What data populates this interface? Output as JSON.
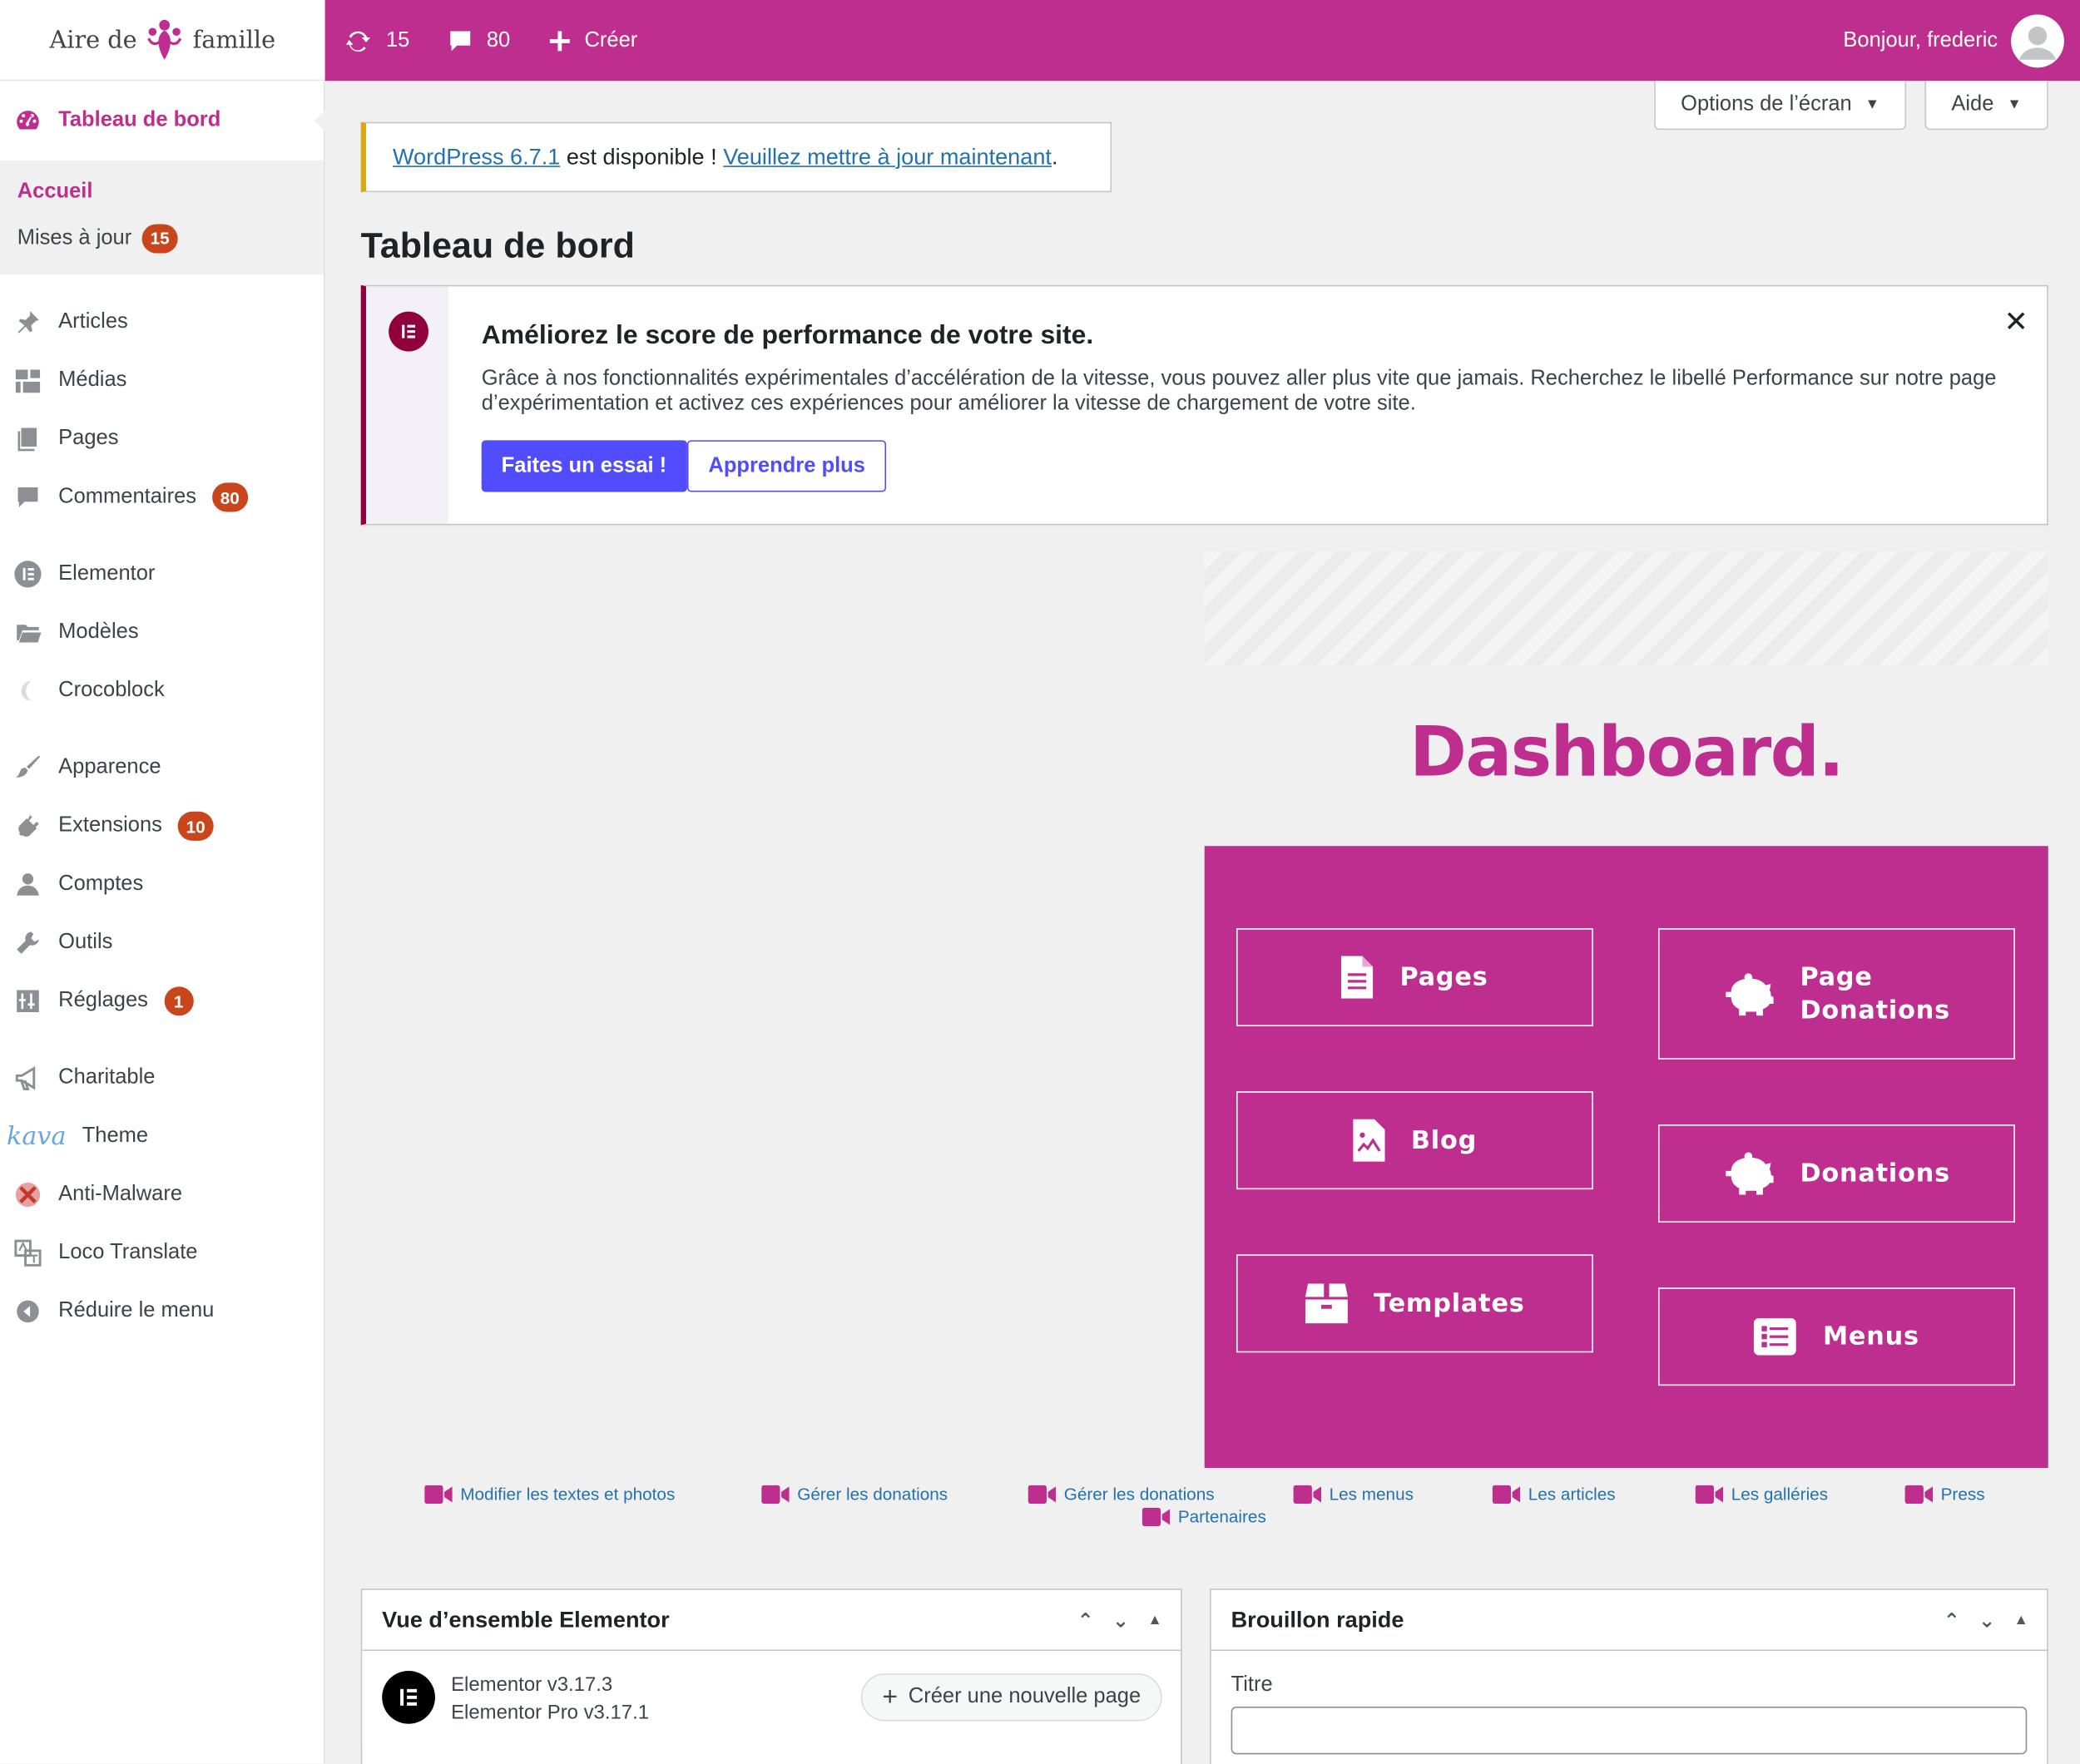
{
  "brand": {
    "logo_left": "Aire de",
    "logo_right": "famille",
    "accent": "#be2e8e"
  },
  "adminbar": {
    "updates_count": "15",
    "comments_count": "80",
    "new_label": "Créer",
    "greeting": "Bonjour, frederic"
  },
  "sidebar": {
    "dashboard": "Tableau de bord",
    "sub_home": "Accueil",
    "sub_updates": "Mises à jour",
    "sub_updates_badge": "15",
    "items": [
      {
        "label": "Articles",
        "icon": "pin-icon"
      },
      {
        "label": "Médias",
        "icon": "media-icon"
      },
      {
        "label": "Pages",
        "icon": "pages-icon"
      },
      {
        "label": "Commentaires",
        "icon": "comment-icon",
        "badge": "80"
      },
      {
        "label": "Elementor",
        "icon": "elementor-icon"
      },
      {
        "label": "Modèles",
        "icon": "folder-icon"
      },
      {
        "label": "Crocoblock",
        "icon": "crocoblock-icon"
      },
      {
        "label": "Apparence",
        "icon": "brush-icon"
      },
      {
        "label": "Extensions",
        "icon": "plugin-icon",
        "badge": "10"
      },
      {
        "label": "Comptes",
        "icon": "user-icon"
      },
      {
        "label": "Outils",
        "icon": "wrench-icon"
      },
      {
        "label": "Réglages",
        "icon": "settings-icon",
        "badge": "1"
      },
      {
        "label": "Charitable",
        "icon": "megaphone-icon"
      },
      {
        "label": "Theme",
        "icon": "kava-icon",
        "prefix": "kava"
      },
      {
        "label": "Anti-Malware",
        "icon": "shield-icon"
      },
      {
        "label": "Loco Translate",
        "icon": "translate-icon"
      },
      {
        "label": "Réduire le menu",
        "icon": "collapse-icon"
      }
    ]
  },
  "screen_options": "Options de l’écran",
  "help": "Aide",
  "update_nag": {
    "version_link": "WordPress 6.7.1",
    "middle": " est disponible ! ",
    "update_link": "Veuillez mettre à jour maintenant",
    "end": "."
  },
  "page_title": "Tableau de bord",
  "notice": {
    "title": "Améliorez le score de performance de votre site.",
    "body": "Grâce à nos fonctionnalités expérimentales d’accélération de la vitesse, vous pouvez aller plus vite que jamais. Recherchez le libellé Performance sur notre page d’expérimentation et activez ces expériences pour améliorer la vitesse de chargement de votre site.",
    "primary": "Faites un essai !",
    "secondary": "Apprendre plus"
  },
  "dashboard": {
    "title": "Dashboard.",
    "buttons": {
      "pages": "Pages",
      "page_donations_1": "Page",
      "page_donations_2": "Donations",
      "blog": "Blog",
      "donations": "Donations",
      "templates": "Templates",
      "menus": "Menus"
    }
  },
  "video_links": {
    "v1": "Modifier les textes et photos",
    "v2": "Gérer les donations",
    "v3": "Gérer les donations",
    "v4": "Partenaires",
    "v5": "Les menus",
    "v6": "Les articles",
    "v7": "Les galléries",
    "v8": "Press"
  },
  "widgets": {
    "elementor_title": "Vue d’ensemble Elementor",
    "elementor_version": "Elementor v3.17.3",
    "elementor_pro_version": "Elementor Pro v3.17.1",
    "create_page": "Créer une nouvelle page",
    "draft_title": "Brouillon rapide",
    "draft_label": "Titre"
  }
}
